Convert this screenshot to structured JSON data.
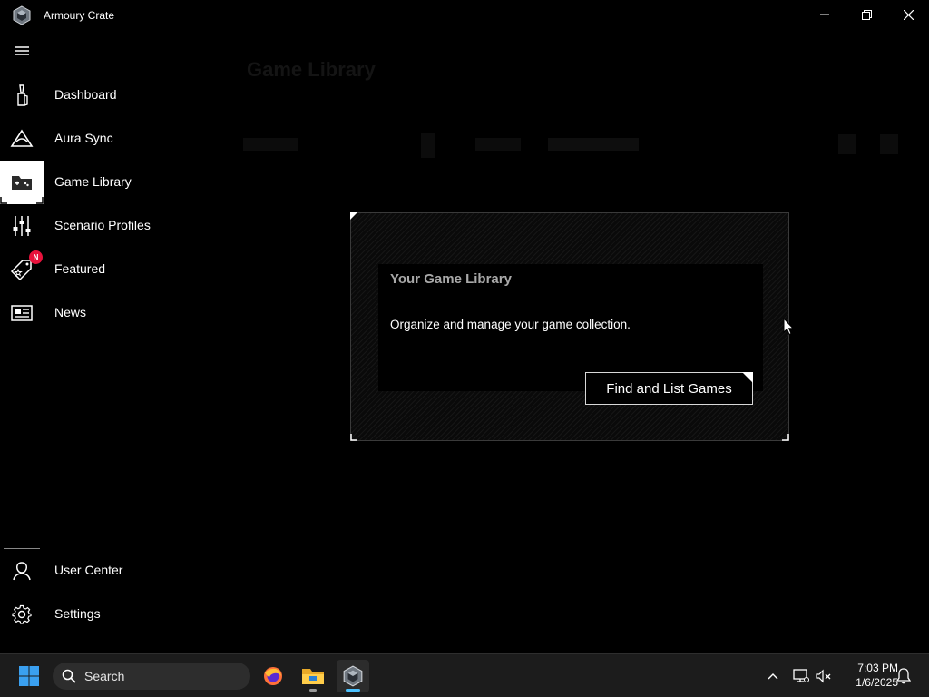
{
  "app": {
    "title": "Armoury Crate"
  },
  "sidebar": {
    "items": [
      {
        "label": "Dashboard",
        "icon": "dashboard-icon"
      },
      {
        "label": "Aura Sync",
        "icon": "aura-sync-icon"
      },
      {
        "label": "Game Library",
        "icon": "game-library-icon",
        "active": true
      },
      {
        "label": "Scenario Profiles",
        "icon": "sliders-icon"
      },
      {
        "label": "Featured",
        "icon": "tag-icon",
        "badge": "N"
      },
      {
        "label": "News",
        "icon": "news-icon"
      }
    ],
    "bottom_items": [
      {
        "label": "User Center",
        "icon": "user-icon"
      },
      {
        "label": "Settings",
        "icon": "gear-icon"
      }
    ]
  },
  "background": {
    "page_title": "Game Library"
  },
  "dialog": {
    "title": "Your Game Library",
    "description": "Organize and manage your game collection.",
    "button_label": "Find and List Games"
  },
  "taskbar": {
    "search_placeholder": "Search",
    "time": "7:03 PM",
    "date": "1/6/2025"
  },
  "colors": {
    "badge": "#e8123c",
    "background": "#000000",
    "taskbar": "#1c1c1c"
  }
}
